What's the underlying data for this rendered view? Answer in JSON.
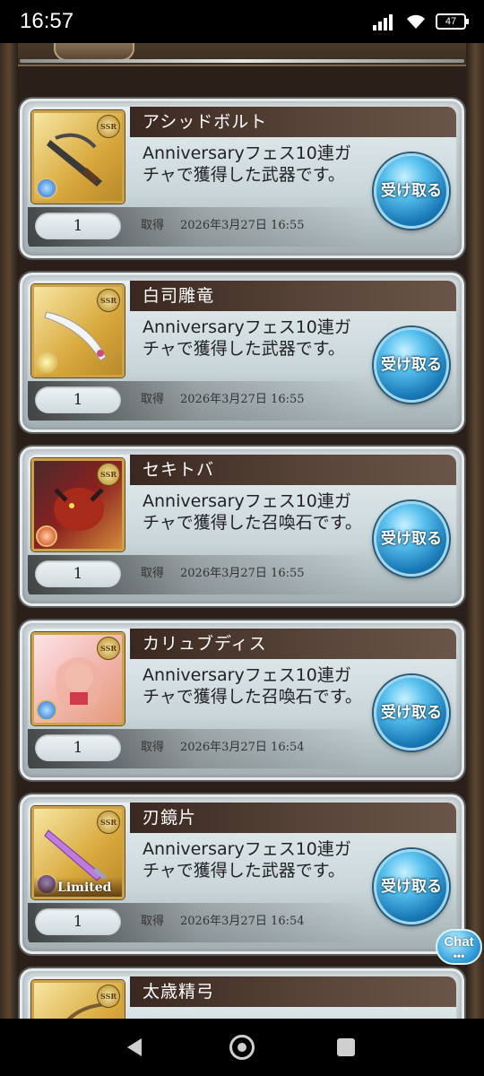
{
  "statusbar": {
    "time": "16:57",
    "battery": "47"
  },
  "items": [
    {
      "name": "アシッドボルト",
      "desc": "Anniversaryフェス10連ガチャで獲得した武器です。",
      "count": "1",
      "label": "取得",
      "date": "2026年3月27日 16:55",
      "button": "受け取る",
      "rarity": "SSR",
      "element": "water",
      "limited": ""
    },
    {
      "name": "白司雕竜",
      "desc": "Anniversaryフェス10連ガチャで獲得した武器です。",
      "count": "1",
      "label": "取得",
      "date": "2026年3月27日 16:55",
      "button": "受け取る",
      "rarity": "SSR",
      "element": "wind",
      "limited": ""
    },
    {
      "name": "セキトバ",
      "desc": "Anniversaryフェス10連ガチャで獲得した召喚石です。",
      "count": "1",
      "label": "取得",
      "date": "2026年3月27日 16:55",
      "button": "受け取る",
      "rarity": "SSR",
      "element": "fire",
      "limited": ""
    },
    {
      "name": "カリュブディス",
      "desc": "Anniversaryフェス10連ガチャで獲得した召喚石です。",
      "count": "1",
      "label": "取得",
      "date": "2026年3月27日 16:54",
      "button": "受け取る",
      "rarity": "SSR",
      "element": "water",
      "limited": ""
    },
    {
      "name": "刃鏡片",
      "desc": "Anniversaryフェス10連ガチャで獲得した武器です。",
      "count": "1",
      "label": "取得",
      "date": "2026年3月27日 16:54",
      "button": "受け取る",
      "rarity": "SSR",
      "element": "dark",
      "limited": "Limited"
    },
    {
      "name": "太歳精弓",
      "desc": "",
      "count": "",
      "label": "",
      "date": "",
      "button": "",
      "rarity": "SSR",
      "element": "wind",
      "limited": ""
    }
  ],
  "chat": {
    "label": "Chat",
    "dots": "•••"
  }
}
